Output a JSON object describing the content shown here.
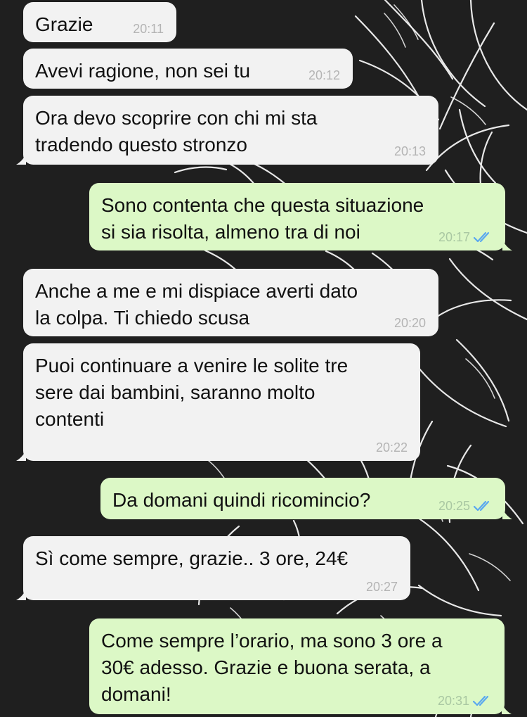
{
  "chat": {
    "messages": [
      {
        "direction": "incoming",
        "text": "Grazie",
        "time": "20:11",
        "status_icon": null
      },
      {
        "direction": "incoming",
        "text": "Avevi ragione, non sei tu",
        "time": "20:12",
        "status_icon": null
      },
      {
        "direction": "incoming",
        "text": "Ora devo scoprire con chi mi sta\ntradendo questo stronzo",
        "time": "20:13",
        "status_icon": null
      },
      {
        "direction": "outgoing",
        "text": "Sono contenta che questa situazione\nsi sia risolta, almeno tra di noi",
        "time": "20:17",
        "status_icon": "double-check-icon"
      },
      {
        "direction": "incoming",
        "text": "Anche a me e mi dispiace averti dato\nla colpa. Ti chiedo scusa",
        "time": "20:20",
        "status_icon": null
      },
      {
        "direction": "incoming",
        "text": "Puoi continuare a venire le solite tre\nsere dai bambini, saranno molto\ncontenti",
        "time": "20:22",
        "status_icon": null
      },
      {
        "direction": "outgoing",
        "text": "Da domani quindi ricomincio?",
        "time": "20:25",
        "status_icon": "double-check-icon"
      },
      {
        "direction": "incoming",
        "text": "Sì come sempre, grazie.. 3 ore, 24€",
        "time": "20:27",
        "status_icon": null
      },
      {
        "direction": "outgoing",
        "text": "Come sempre l’orario, ma sono 3 ore a\n30€ adesso. Grazie e buona serata, a\ndomani!",
        "time": "20:31",
        "status_icon": "double-check-icon"
      }
    ]
  },
  "theme": {
    "wallpaper": "#1f1f1f",
    "wallpaper_line": "#f3f3f3",
    "incoming_bubble": "#f2f2f2",
    "outgoing_bubble": "#dcf8c6",
    "read_ticks": "#5aa8ef",
    "text": "#111111"
  }
}
